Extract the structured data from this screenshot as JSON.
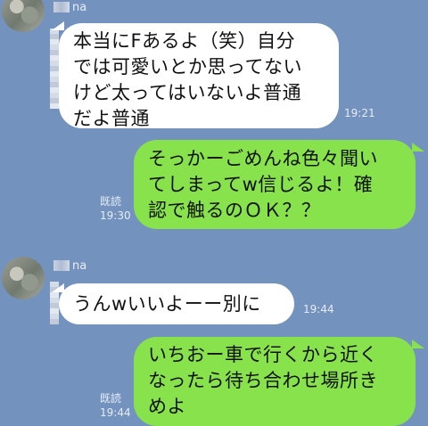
{
  "messages": [
    {
      "sender": "other",
      "name_suffix": "na",
      "text": "本当にFあるよ（笑）自分\nでは可愛いとか思ってない\nけど太ってはいないよ普通\nだよ普通",
      "time": "19:21"
    },
    {
      "sender": "me",
      "text": "そっかーごめんね色々聞い\nてしまってw信じるよ！確\n認で触るのＯＫ？？",
      "read_label": "既読",
      "time": "19:30"
    },
    {
      "sender": "other",
      "name_suffix": "na",
      "text": "うんwいいよーー別に",
      "time": "19:44"
    },
    {
      "sender": "me",
      "text": "いちおー車で行くから近く\nなったら待ち合わせ場所き\nめよ",
      "read_label": "既読",
      "time": "19:44"
    }
  ]
}
